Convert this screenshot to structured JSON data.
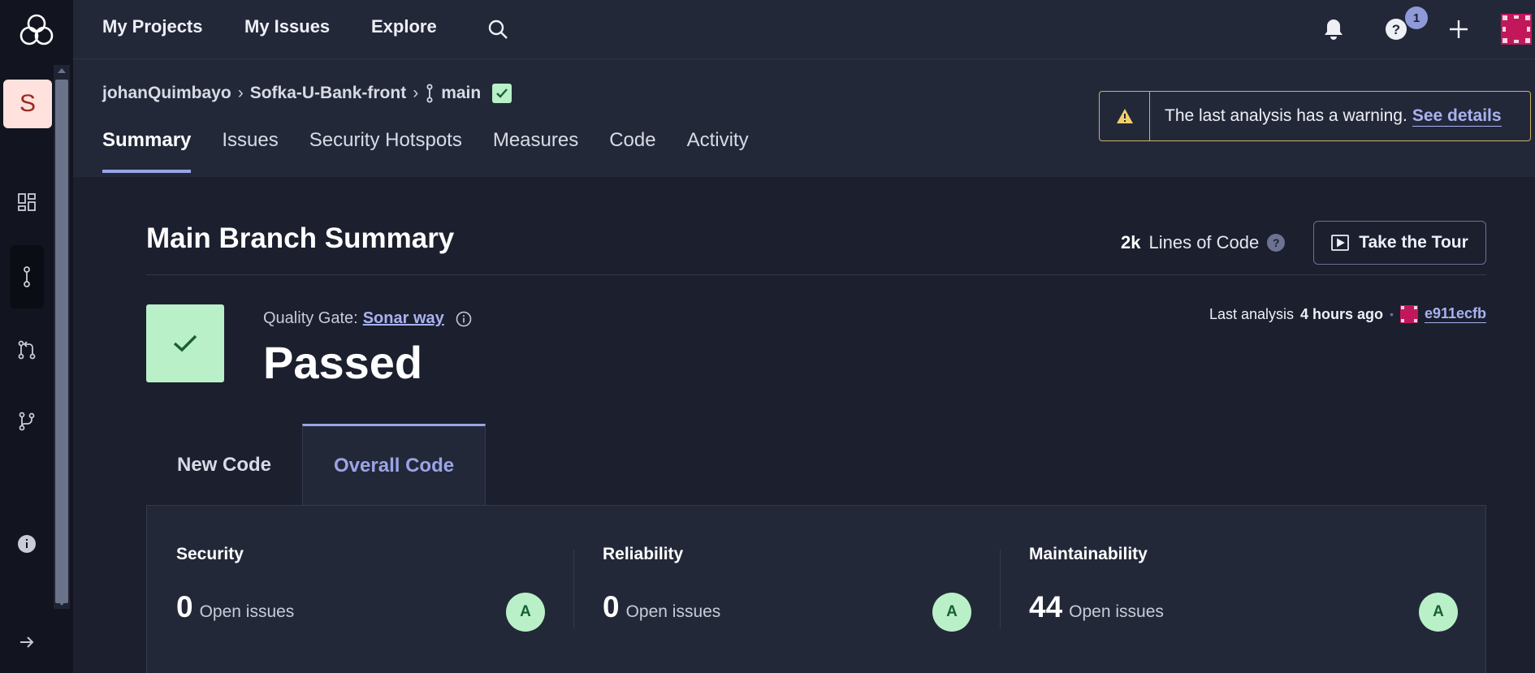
{
  "topnav": {
    "links": [
      "My Projects",
      "My Issues",
      "Explore"
    ],
    "notifications_count": "1"
  },
  "sidebar": {
    "project_initial": "S"
  },
  "breadcrumb": {
    "owner": "johanQuimbayo",
    "project": "Sofka-U-Bank-front",
    "branch": "main"
  },
  "project_tabs": [
    "Summary",
    "Issues",
    "Security Hotspots",
    "Measures",
    "Code",
    "Activity"
  ],
  "warning": {
    "text": "The last analysis has a warning.",
    "link": "See details"
  },
  "summary": {
    "title": "Main Branch Summary",
    "loc_value": "2k",
    "loc_label": "Lines of Code",
    "tour_button": "Take the Tour"
  },
  "quality_gate": {
    "label": "Quality Gate:",
    "profile": "Sonar way",
    "status": "Passed"
  },
  "last_analysis": {
    "label": "Last analysis",
    "when": "4 hours ago",
    "commit": "e911ecfb"
  },
  "code_tabs": [
    "New Code",
    "Overall Code"
  ],
  "metrics": [
    {
      "title": "Security",
      "value": "0",
      "unit": "Open issues",
      "rating": "A"
    },
    {
      "title": "Reliability",
      "value": "0",
      "unit": "Open issues",
      "rating": "A"
    },
    {
      "title": "Maintainability",
      "value": "44",
      "unit": "Open issues",
      "rating": "A"
    }
  ],
  "colors": {
    "background": "#1b1f2e",
    "panel": "#232839",
    "accent": "#9aa4e6",
    "passed": "#b9f0c8",
    "warning_border": "#c9b568"
  }
}
